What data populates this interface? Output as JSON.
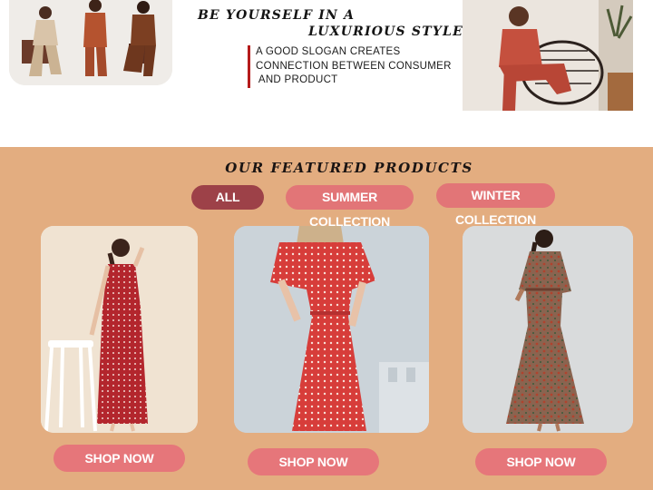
{
  "hero": {
    "tagline_line1": "BE YOURSELF IN A",
    "tagline_line2": "LUXURIOUS STYLE",
    "slogan_line1": "A GOOD SLOGAN CREATES",
    "slogan_line2": "CONNECTION BETWEEN CONSUMER",
    "slogan_line3": " AND PRODUCT"
  },
  "featured": {
    "title": "OUR FEATURED PRODUCTS",
    "filters": [
      {
        "label": "ALL",
        "active": true
      },
      {
        "label": "SUMMER COLLECTION",
        "active": false
      },
      {
        "label": "WINTER COLLECTION",
        "active": false
      }
    ],
    "products": [
      {
        "button_label": "SHOP NOW"
      },
      {
        "button_label": "SHOP NOW"
      },
      {
        "button_label": "SHOP NOW"
      }
    ]
  },
  "colors": {
    "section_bg": "#e3ad80",
    "pill_active": "#9d4148",
    "pill_inactive": "#e27577",
    "shop_button": "#e6767a",
    "slogan_accent": "#b51b1b"
  }
}
